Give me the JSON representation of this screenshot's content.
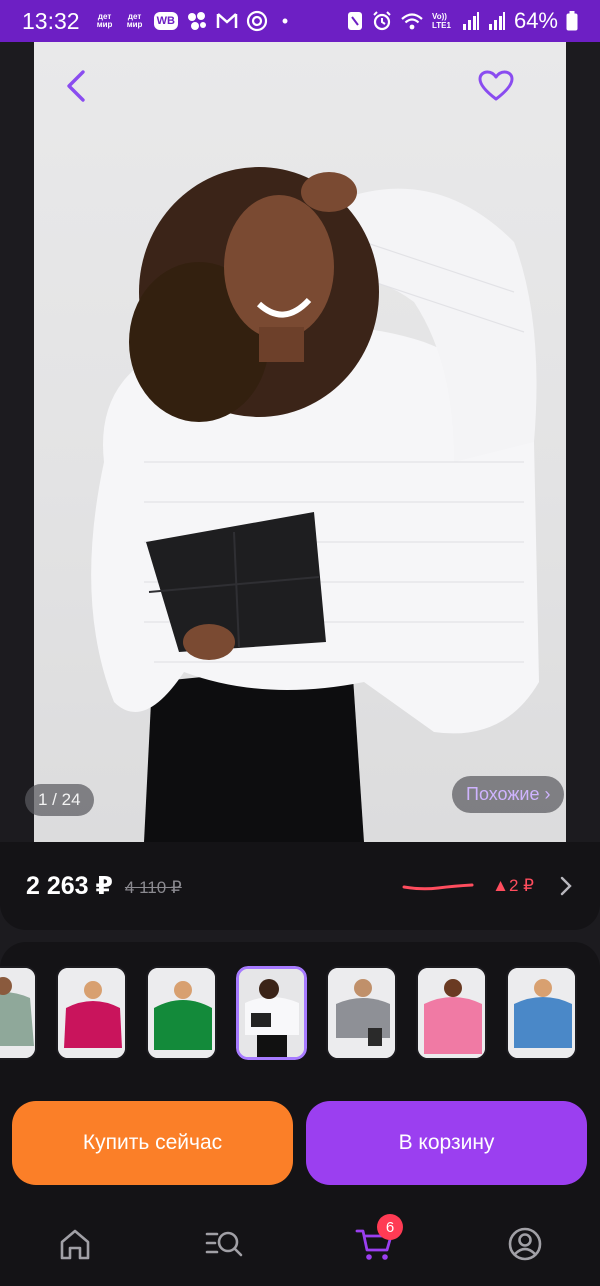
{
  "status_bar": {
    "time": "13:32",
    "badge_detmir_1": "дет\nмир",
    "badge_detmir_2": "дет\nмир",
    "badge_wb": "WB",
    "network_label": "Vo)) LTE1",
    "battery": "64%",
    "icons": [
      "bluetooth-dots-icon",
      "gmail-icon",
      "at-icon",
      "nfc-icon",
      "alarm-icon",
      "wifi-icon",
      "signal-icon",
      "battery-icon"
    ],
    "background_color": "#6d1fc4"
  },
  "product": {
    "image_counter": "1 / 24",
    "similar_label": "Похожие ›"
  },
  "price": {
    "current": "2 263 ₽",
    "old": "4 110 ₽",
    "change": "▲2 ₽",
    "change_color": "#ff4d5e"
  },
  "thumbnails": [
    {
      "name": "sage-sweater"
    },
    {
      "name": "magenta-sweater"
    },
    {
      "name": "green-sweater"
    },
    {
      "name": "white-sweater",
      "selected": true
    },
    {
      "name": "grey-sweater"
    },
    {
      "name": "pink-sweater"
    },
    {
      "name": "blue-sweater"
    }
  ],
  "actions": {
    "buy_now": "Купить сейчас",
    "add_to_cart": "В корзину",
    "buy_color": "#fb7f28",
    "cart_color": "#9b3ff0"
  },
  "bottom_nav": {
    "cart_count": "6",
    "items": [
      "home-icon",
      "catalog-search-icon",
      "cart-icon",
      "profile-icon"
    ],
    "accent_color": "#9b3ff0"
  }
}
